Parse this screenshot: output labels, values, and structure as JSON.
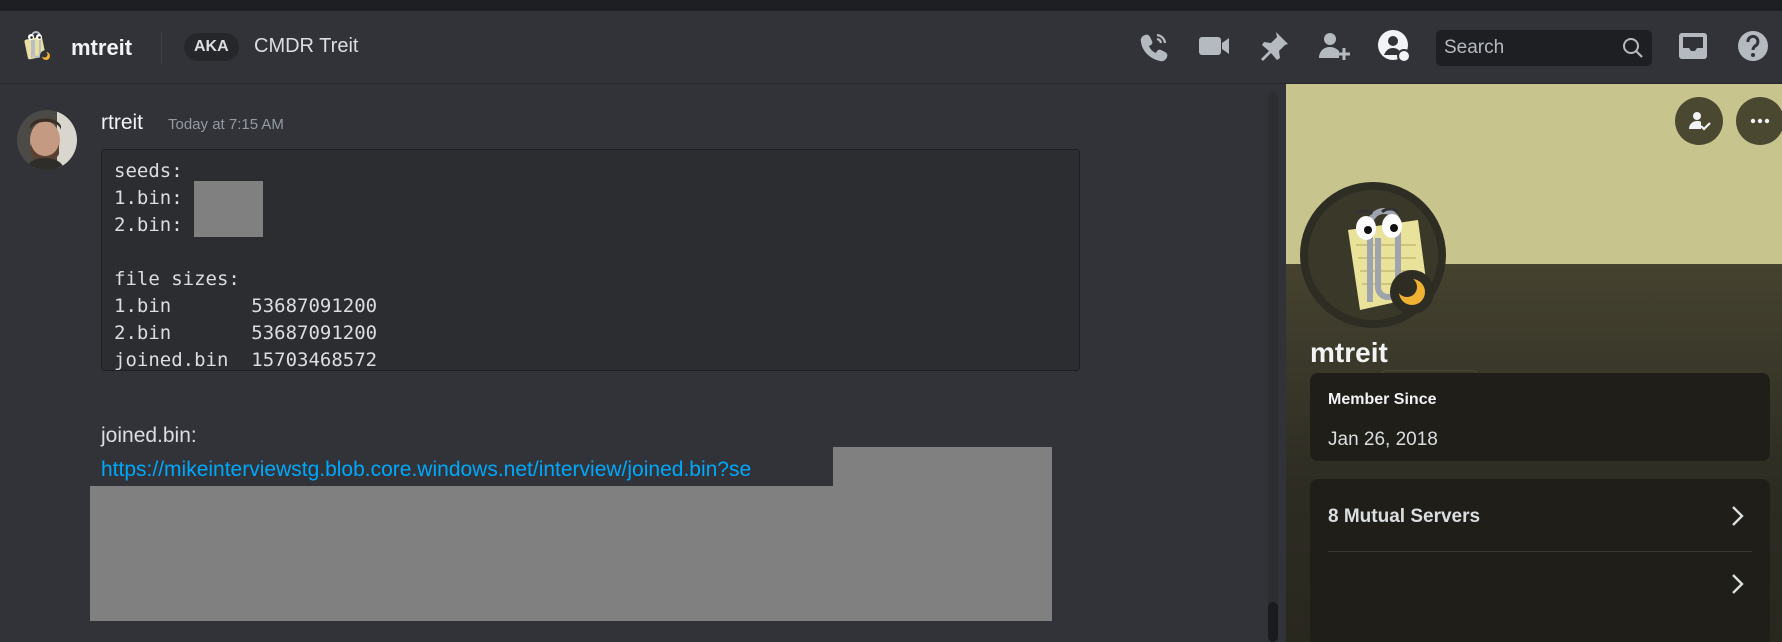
{
  "header": {
    "dm_name": "mtreit",
    "aka_label": "AKA",
    "aka_name": "CMDR Treit",
    "search": {
      "placeholder": "Search"
    },
    "icons": [
      "start-voice-call-icon",
      "start-video-call-icon",
      "pinned-messages-icon",
      "add-friends-to-dm-icon",
      "user-profile-icon",
      "search-icon",
      "inbox-icon",
      "help-icon"
    ]
  },
  "message": {
    "author": "rtreit",
    "timestamp": "Today at 7:15 AM",
    "code_lines": [
      "seeds:",
      "1.bin:",
      "2.bin:",
      "",
      "file sizes:",
      "1.bin       53687091200",
      "2.bin       53687091200",
      "joined.bin  15703468572"
    ],
    "text": "joined.bin:",
    "link": "https://mikeinterviewstg.blob.core.windows.net/interview/joined.bin?se"
  },
  "profile": {
    "display_name": "mtreit",
    "username": "mtreit",
    "badges": [
      "hypesquad-icon",
      "nitro-gem-icon",
      "hashtag-icon"
    ],
    "member_since": {
      "label": "Member Since",
      "value": "Jan 26, 2018"
    },
    "mutual_servers": "8 Mutual Servers",
    "colors": {
      "banner": "#c7c48d",
      "body": "#45422f",
      "link": "#00a8fc"
    }
  }
}
